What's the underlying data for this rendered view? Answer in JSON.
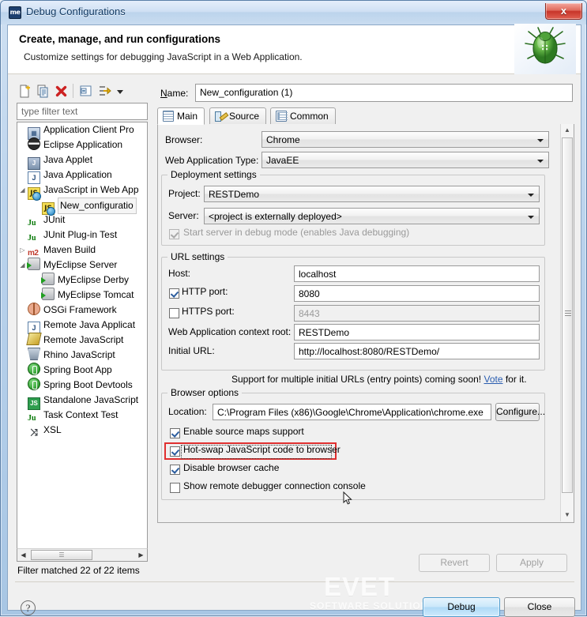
{
  "window": {
    "title": "Debug Configurations",
    "app_icon": "me",
    "close_label": "x"
  },
  "banner": {
    "title": "Create, manage, and run configurations",
    "subtitle": "Customize settings for debugging JavaScript in a Web Application.",
    "icon": "green-bug-icon"
  },
  "tree_toolbar": {
    "buttons": [
      {
        "name": "new-configuration-icon",
        "tip": "New launch configuration"
      },
      {
        "name": "duplicate-configuration-icon",
        "tip": "Duplicate"
      },
      {
        "name": "delete-configuration-icon",
        "tip": "Delete"
      },
      {
        "name": "collapse-all-icon",
        "tip": "Collapse All"
      },
      {
        "name": "filter-configurations-icon",
        "tip": "Filter launch configurations"
      },
      {
        "name": "view-menu-chevron-icon",
        "tip": "View Menu"
      }
    ]
  },
  "filter": {
    "placeholder": "type filter text",
    "value": "",
    "status": "Filter matched 22 of 22 items"
  },
  "tree": {
    "items": [
      {
        "label": "Application Client Pro",
        "icon": "app-client-icon",
        "indent": 1,
        "arrow": "",
        "selected": false
      },
      {
        "label": "Eclipse Application",
        "icon": "eclipse-icon",
        "indent": 1,
        "arrow": "",
        "selected": false
      },
      {
        "label": "Java Applet",
        "icon": "java-applet-icon",
        "indent": 1,
        "arrow": "",
        "selected": false
      },
      {
        "label": "Java Application",
        "icon": "java-icon",
        "indent": 1,
        "arrow": "",
        "selected": false
      },
      {
        "label": "JavaScript in Web App",
        "icon": "javascript-web-icon",
        "indent": 1,
        "arrow": "expanded",
        "selected": false
      },
      {
        "label": "New_configuratio",
        "icon": "javascript-web-icon",
        "indent": 2,
        "arrow": "",
        "selected": true
      },
      {
        "label": "JUnit",
        "icon": "junit-icon",
        "indent": 1,
        "arrow": "",
        "selected": false
      },
      {
        "label": "JUnit Plug-in Test",
        "icon": "junit-plugin-icon",
        "indent": 1,
        "arrow": "",
        "selected": false
      },
      {
        "label": "Maven Build",
        "icon": "maven-icon",
        "indent": 1,
        "arrow": "collapsed",
        "selected": false
      },
      {
        "label": "MyEclipse Server",
        "icon": "server-icon",
        "indent": 1,
        "arrow": "expanded",
        "selected": false
      },
      {
        "label": "MyEclipse Derby",
        "icon": "server-icon",
        "indent": 2,
        "arrow": "",
        "selected": false
      },
      {
        "label": "MyEclipse Tomcat",
        "icon": "server-icon",
        "indent": 2,
        "arrow": "",
        "selected": false
      },
      {
        "label": "OSGi Framework",
        "icon": "osgi-icon",
        "indent": 1,
        "arrow": "",
        "selected": false
      },
      {
        "label": "Remote Java Applicat",
        "icon": "remote-java-icon",
        "indent": 1,
        "arrow": "",
        "selected": false
      },
      {
        "label": "Remote JavaScript",
        "icon": "remote-js-icon",
        "indent": 1,
        "arrow": "",
        "selected": false
      },
      {
        "label": "Rhino JavaScript",
        "icon": "rhino-icon",
        "indent": 1,
        "arrow": "",
        "selected": false
      },
      {
        "label": "Spring Boot App",
        "icon": "spring-boot-icon",
        "indent": 1,
        "arrow": "",
        "selected": false
      },
      {
        "label": "Spring Boot Devtools",
        "icon": "spring-devtools-icon",
        "indent": 1,
        "arrow": "",
        "selected": false
      },
      {
        "label": "Standalone JavaScript",
        "icon": "standalone-js-icon",
        "indent": 1,
        "arrow": "",
        "selected": false
      },
      {
        "label": "Task Context Test",
        "icon": "task-context-icon",
        "indent": 1,
        "arrow": "",
        "selected": false
      },
      {
        "label": "XSL",
        "icon": "xsl-icon",
        "indent": 1,
        "arrow": "",
        "selected": false
      }
    ]
  },
  "config": {
    "name_label": "Name:",
    "name_value": "New_configuration (1)",
    "tabs": [
      {
        "label": "Main",
        "icon": "main-tab-icon",
        "active": true
      },
      {
        "label": "Source",
        "icon": "source-tab-icon",
        "active": false
      },
      {
        "label": "Common",
        "icon": "common-tab-icon",
        "active": false
      }
    ],
    "browser_label": "Browser:",
    "browser_value": "Chrome",
    "webapp_type_label": "Web Application Type:",
    "webapp_type_value": "JavaEE",
    "deployment": {
      "group_title": "Deployment settings",
      "project_label": "Project:",
      "project_value": "RESTDemo",
      "server_label": "Server:",
      "server_value": "<project is externally deployed>",
      "start_server_label": "Start server in debug mode (enables Java debugging)",
      "start_server_checked": true,
      "start_server_disabled": true
    },
    "url": {
      "group_title": "URL settings",
      "host_label": "Host:",
      "host_value": "localhost",
      "http_port_label": "HTTP port:",
      "http_port_value": "8080",
      "http_port_checked": true,
      "https_port_label": "HTTPS port:",
      "https_port_value": "8443",
      "https_port_checked": false,
      "context_root_label": "Web Application context root:",
      "context_root_value": "RESTDemo",
      "initial_url_label": "Initial URL:",
      "initial_url_value": "http://localhost:8080/RESTDemo/",
      "note_prefix": "Support for multiple initial URLs (entry points) coming soon! ",
      "note_link": "Vote",
      "note_suffix": " for it."
    },
    "browser_options": {
      "group_title": "Browser options",
      "location_label": "Location:",
      "location_value": "C:\\Program Files (x86)\\Google\\Chrome\\Application\\chrome.exe",
      "configure_label": "Configure...",
      "checkboxes": [
        {
          "label": "Enable source maps support",
          "checked": true,
          "focused": false,
          "highlighted": false
        },
        {
          "label": "Hot-swap JavaScript code to browser",
          "checked": true,
          "focused": true,
          "highlighted": true
        },
        {
          "label": "Disable browser cache",
          "checked": true,
          "focused": false,
          "highlighted": false
        },
        {
          "label": "Show remote debugger connection console",
          "checked": false,
          "focused": false,
          "highlighted": false
        }
      ]
    }
  },
  "footer": {
    "revert_label": "Revert",
    "revert_disabled": true,
    "apply_label": "Apply",
    "apply_disabled": true,
    "debug_label": "Debug",
    "close_label": "Close",
    "help_icon": "help-question-icon"
  },
  "watermark": {
    "line1": "EVET",
    "line2": "SOFTWARE SOLUTIONS"
  },
  "colors": {
    "accent": "#2a5db0",
    "highlight_box": "#e03030",
    "titlebar": "#cfe0f4",
    "close_button": "#c7352a",
    "checkmark": "#2c5d9e"
  }
}
